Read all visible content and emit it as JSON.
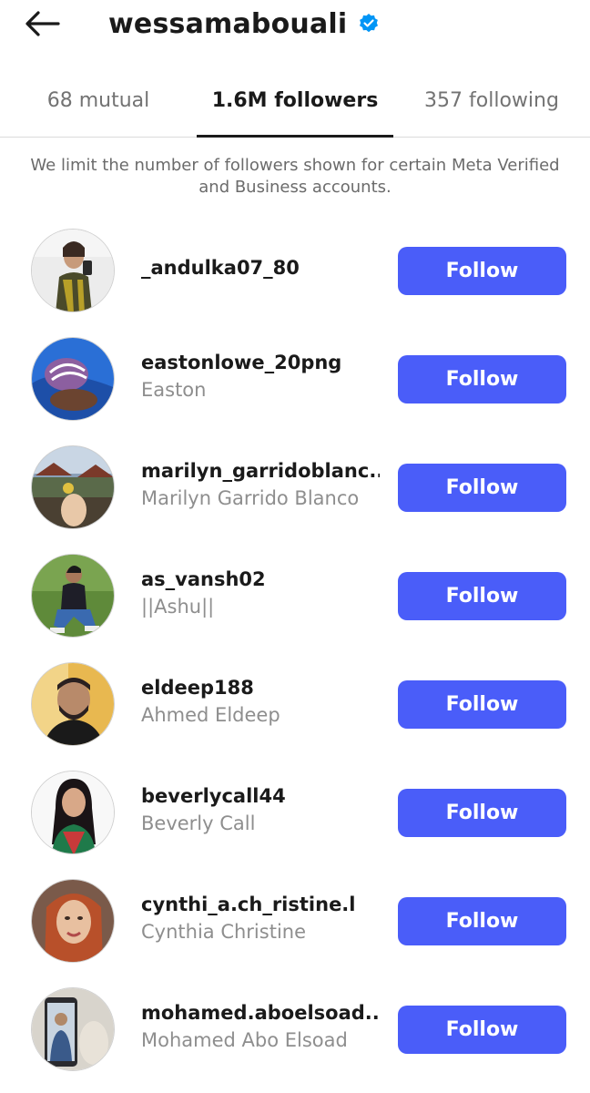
{
  "header": {
    "title": "wessamabouali",
    "back_icon": "arrow-left-icon",
    "verified_icon": "verified-badge-icon",
    "verified_color": "#0095f6"
  },
  "tabs": [
    {
      "label": "68 mutual",
      "active": false
    },
    {
      "label": "1.6M followers",
      "active": true
    },
    {
      "label": "357 following",
      "active": false
    }
  ],
  "notice": "We limit the number of followers shown for certain Meta Verified and Business accounts.",
  "follow_label": "Follow",
  "accent_color": "#4a5df9",
  "followers": [
    {
      "username": "_andulka07_80",
      "fullname": ""
    },
    {
      "username": "eastonlowe_20png",
      "fullname": "Easton"
    },
    {
      "username": "marilyn_garridoblanc...",
      "fullname": "Marilyn Garrido Blanco"
    },
    {
      "username": "as_vansh02",
      "fullname": "||Ashu||"
    },
    {
      "username": "eldeep188",
      "fullname": "Ahmed Eldeep"
    },
    {
      "username": "beverlycall44",
      "fullname": "Beverly Call"
    },
    {
      "username": "cynthi_a.ch_ristine.l",
      "fullname": "Cynthia Christine"
    },
    {
      "username": "mohamed.aboelsoad....",
      "fullname": "Mohamed Abo Elsoad"
    }
  ]
}
